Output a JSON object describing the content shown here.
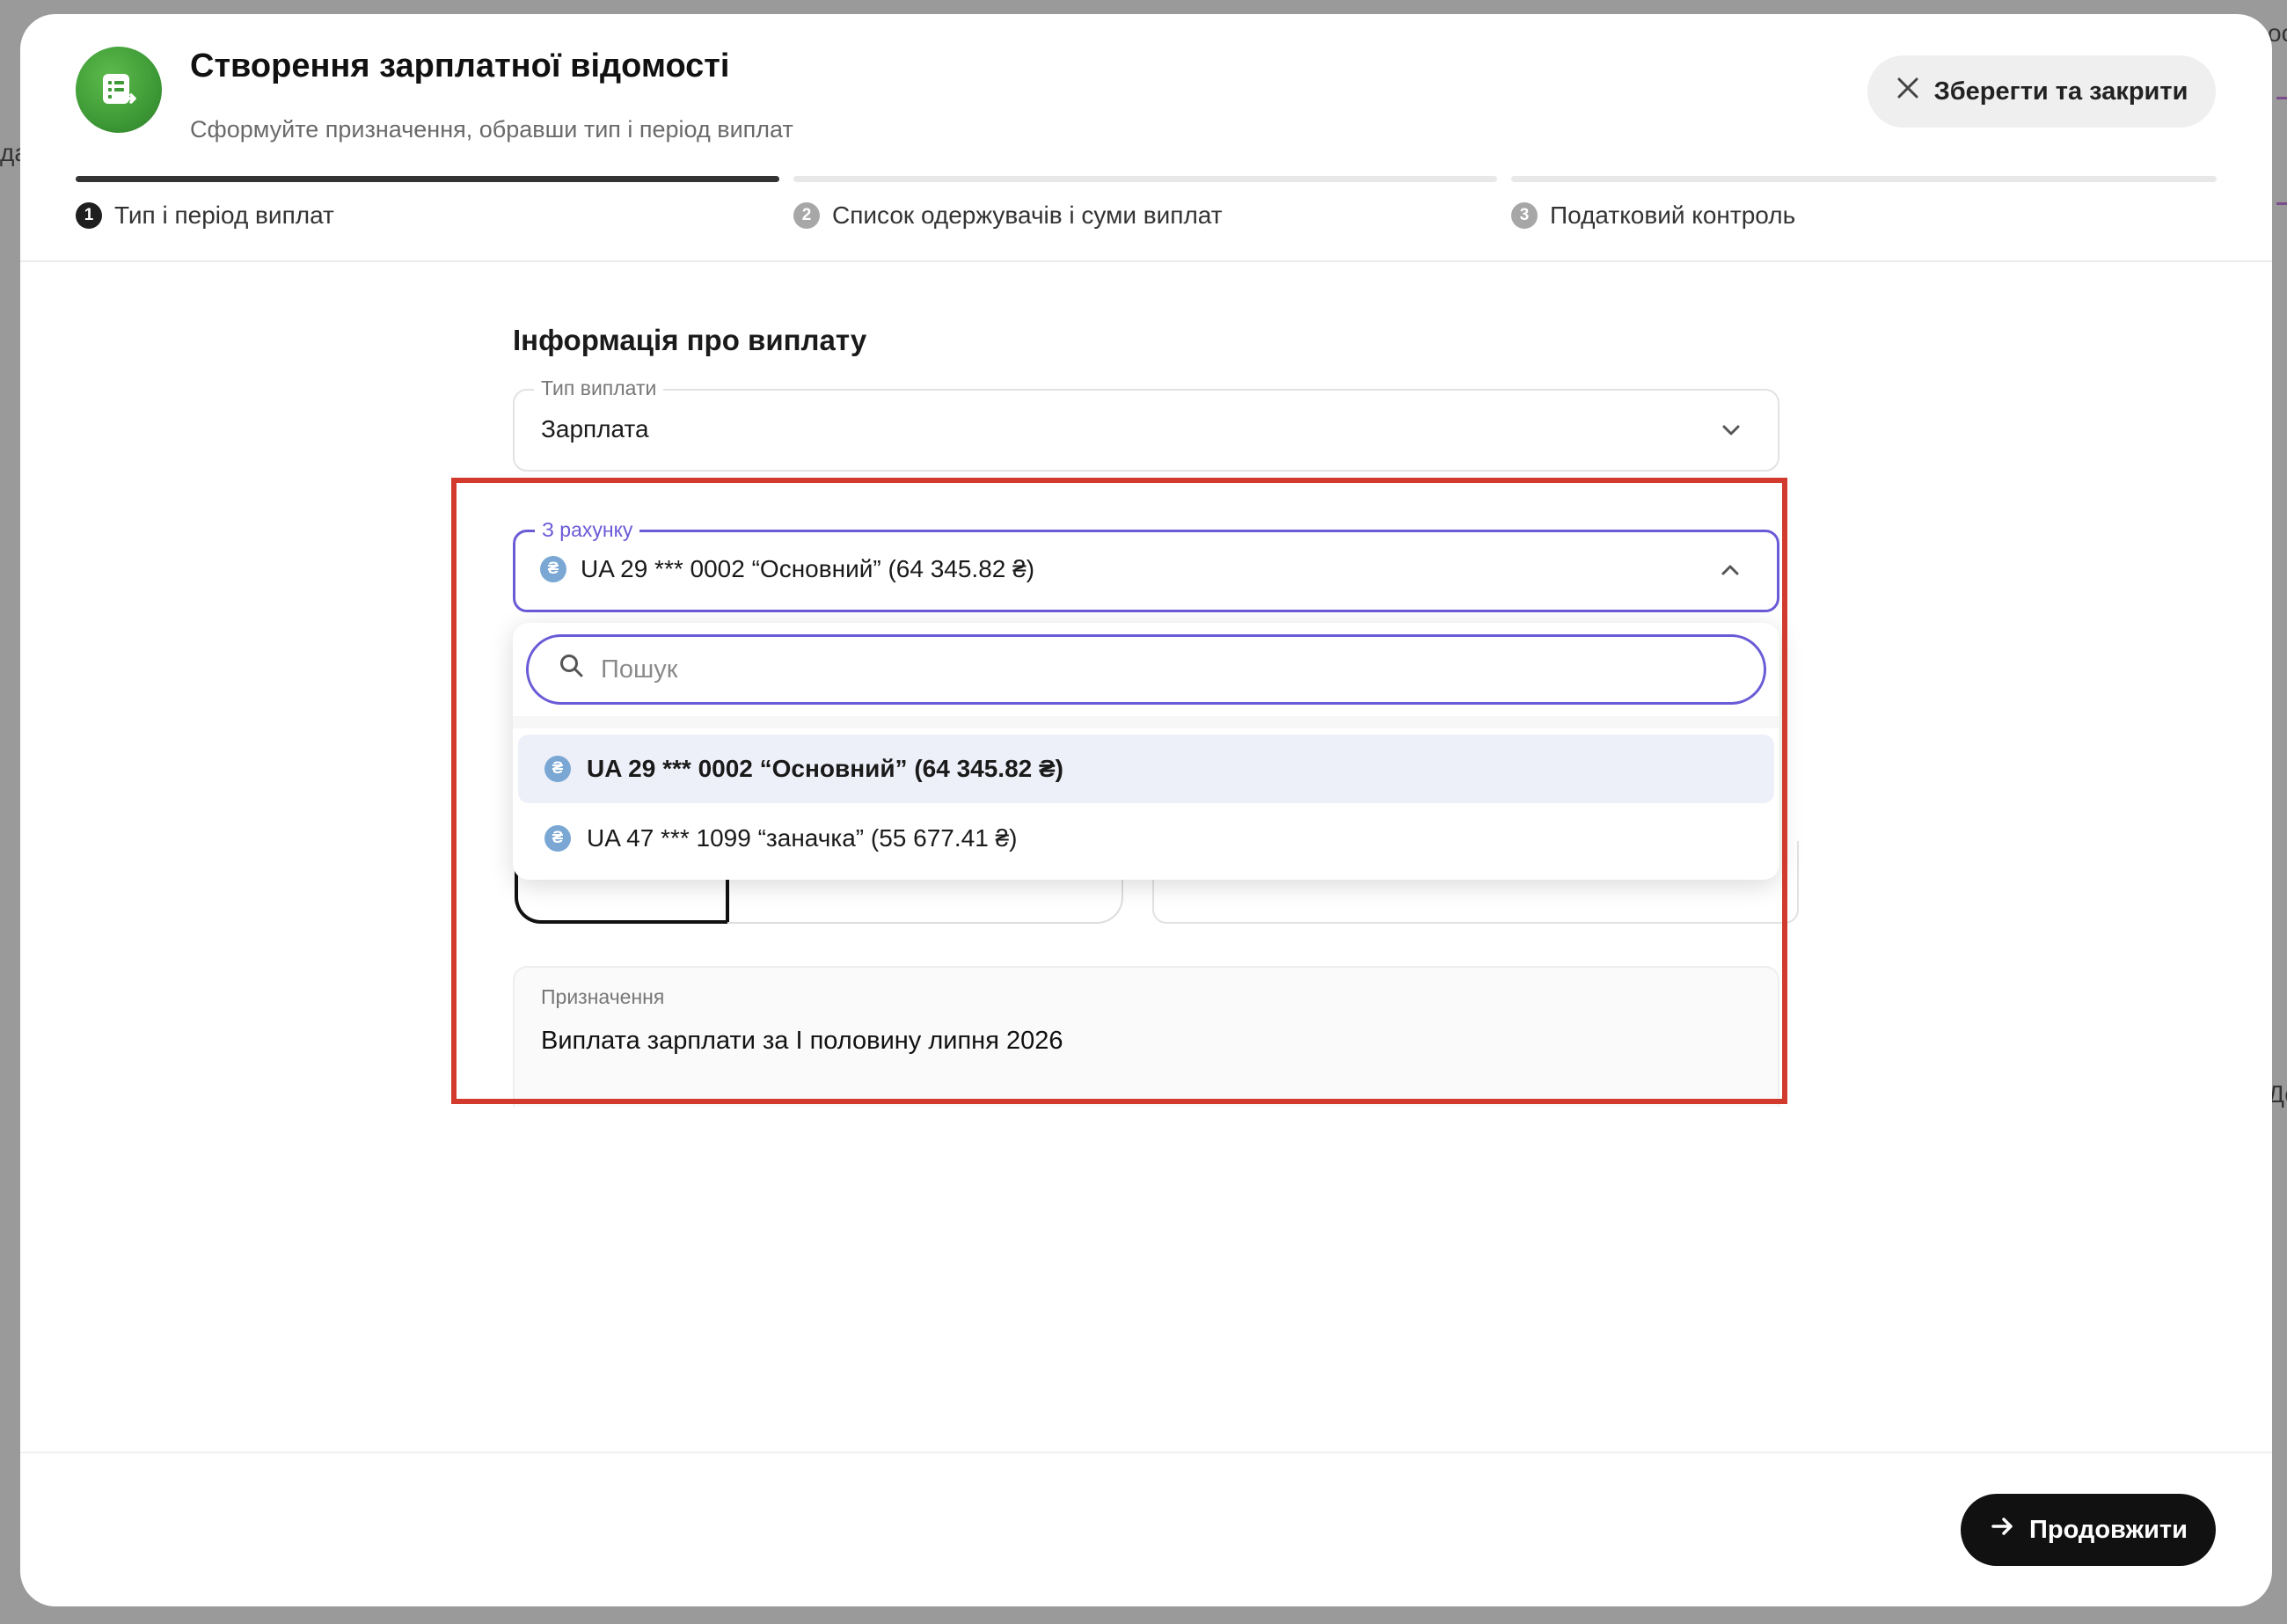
{
  "background": {
    "left_partial_text": "да",
    "right_partial_text_top": "ос",
    "right_partial_text_mid": "До"
  },
  "modal": {
    "title": "Створення зарплатної відомості",
    "subtitle": "Сформуйте призначення, обравши тип і період виплат",
    "save_close_label": "Зберегти та закрити",
    "icon": "payroll-document-icon",
    "accent_color": "#4aa83f"
  },
  "stepper": {
    "steps": [
      {
        "number": "1",
        "label": "Тип і період виплат",
        "active": true
      },
      {
        "number": "2",
        "label": "Список одержувачів і суми виплат",
        "active": false
      },
      {
        "number": "3",
        "label": "Податковий контроль",
        "active": false
      }
    ]
  },
  "form": {
    "section_title": "Інформація про виплату",
    "payment_type": {
      "label": "Тип виплати",
      "value": "Зарплата"
    },
    "from_account": {
      "label": "З рахунку",
      "value": "UA 29 *** 0002 “Основний” (64 345.82 ₴)",
      "focus_color": "#6a5bd6"
    },
    "dropdown": {
      "search_placeholder": "Пошук",
      "options": [
        {
          "label": "UA 29 *** 0002 “Основний” (64 345.82 ₴)",
          "selected": true
        },
        {
          "label": "UA 47 *** 1099 “заначка” (55 677.41 ₴)",
          "selected": false
        }
      ]
    },
    "purpose": {
      "label": "Призначення",
      "value": "Виплата зарплати за І половину липня 2026"
    }
  },
  "footer": {
    "continue_label": "Продовжити"
  },
  "highlight_color": "#d13a2c",
  "currency_glyph": "₴"
}
